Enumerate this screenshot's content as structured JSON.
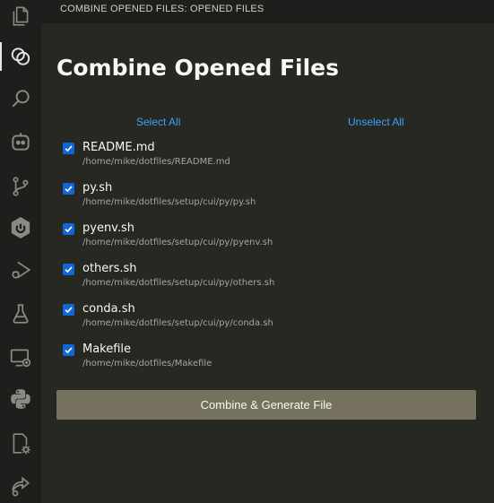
{
  "header": {
    "title": "COMBINE OPENED FILES: OPENED FILES"
  },
  "main": {
    "title": "Combine Opened Files",
    "select_all": "Select All",
    "unselect_all": "Unselect All",
    "files": [
      {
        "name": "README.md",
        "path": "/home/mike/dotfiles/README.md",
        "checked": true
      },
      {
        "name": "py.sh",
        "path": "/home/mike/dotfiles/setup/cui/py/py.sh",
        "checked": true
      },
      {
        "name": "pyenv.sh",
        "path": "/home/mike/dotfiles/setup/cui/py/pyenv.sh",
        "checked": true
      },
      {
        "name": "others.sh",
        "path": "/home/mike/dotfiles/setup/cui/py/others.sh",
        "checked": true
      },
      {
        "name": "conda.sh",
        "path": "/home/mike/dotfiles/setup/cui/py/conda.sh",
        "checked": true
      },
      {
        "name": "Makefile",
        "path": "/home/mike/dotfiles/Makefile",
        "checked": true
      }
    ],
    "generate_button": "Combine & Generate File"
  },
  "activity_bar": {
    "items": [
      {
        "icon": "files-icon"
      },
      {
        "icon": "combine-files-icon",
        "active": true
      },
      {
        "icon": "search-icon"
      },
      {
        "icon": "copilot-icon"
      },
      {
        "icon": "source-control-icon"
      },
      {
        "icon": "spring-boot-icon"
      },
      {
        "icon": "run-debug-icon"
      },
      {
        "icon": "testing-icon"
      },
      {
        "icon": "remote-explorer-icon"
      },
      {
        "icon": "python-icon"
      },
      {
        "icon": "file-settings-icon"
      },
      {
        "icon": "share-icon"
      }
    ]
  },
  "colors": {
    "background": "#272822",
    "sidebar": "#1e1f1c",
    "link": "#3ea0ff",
    "checkbox": "#0f67d9",
    "button": "#75715e"
  }
}
